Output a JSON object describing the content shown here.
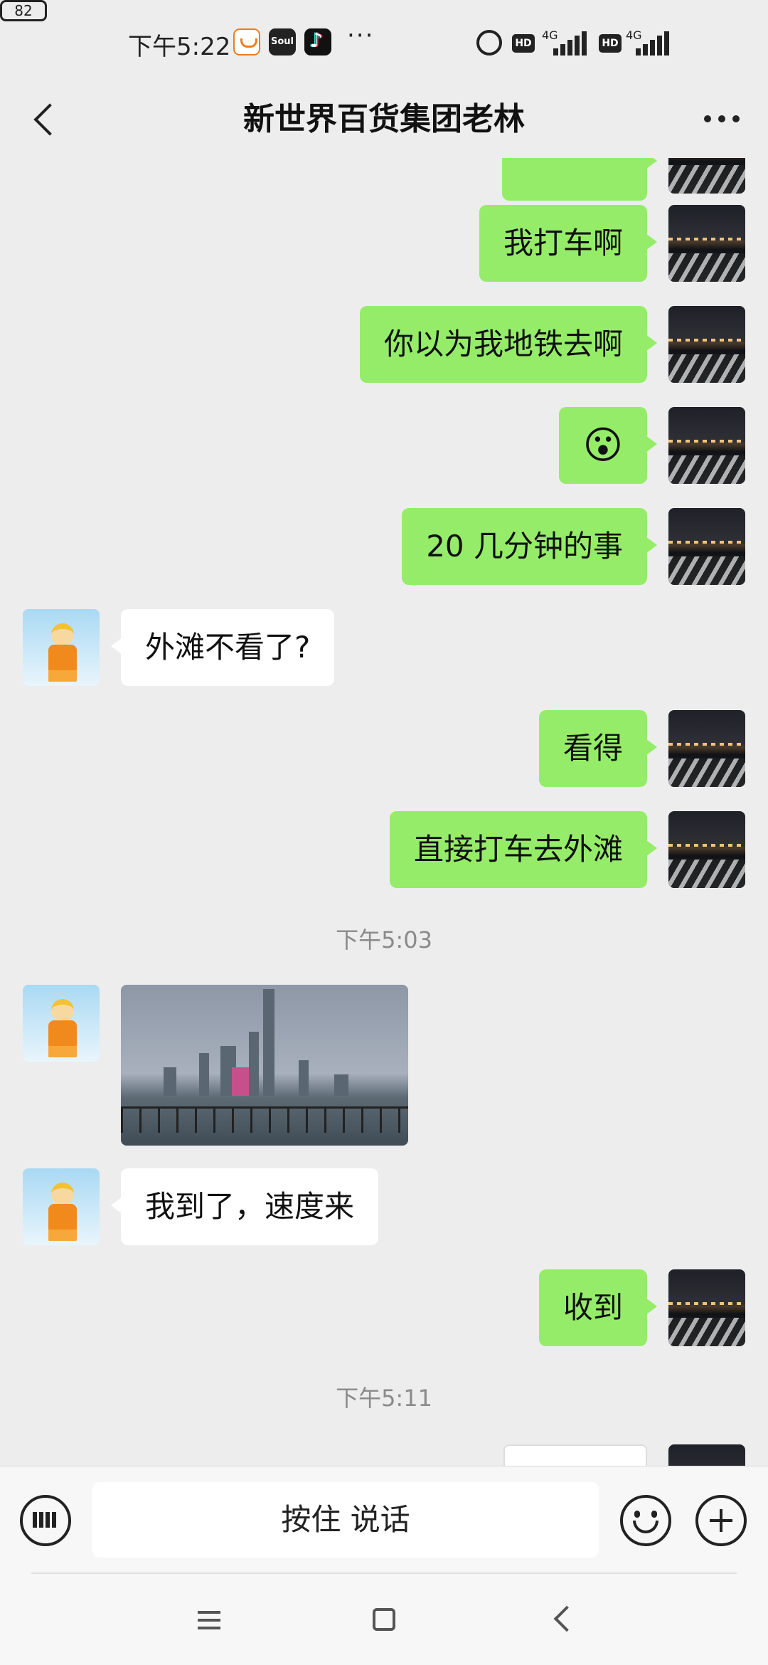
{
  "status_bar": {
    "time": "下午5:22",
    "app_icons": [
      "didi-icon",
      "soul-icon",
      "tiktok-icon"
    ],
    "soul_label": "Soul",
    "more": "···",
    "hd": "HD",
    "network1": "4G",
    "network2": "4G",
    "battery": "82"
  },
  "header": {
    "title": "新世界百货集团老林"
  },
  "messages": [
    {
      "side": "out",
      "text": "我打车啊"
    },
    {
      "side": "out",
      "text": "你以为我地铁去啊"
    },
    {
      "side": "out",
      "text": "😮"
    },
    {
      "side": "out",
      "text": "20 几分钟的事"
    },
    {
      "side": "in",
      "text": "外滩不看了?"
    },
    {
      "side": "out",
      "text": "看得"
    },
    {
      "side": "out",
      "text": "直接打车去外滩"
    },
    {
      "side": "time",
      "text": "下午5:03"
    },
    {
      "side": "in",
      "type": "image"
    },
    {
      "side": "in",
      "text": "我到了，速度来"
    },
    {
      "side": "out",
      "text": "收到"
    },
    {
      "side": "time",
      "text": "下午5:11"
    }
  ],
  "input_bar": {
    "hold_to_talk": "按住 说话"
  },
  "colors": {
    "outgoing_bubble": "#95ec69",
    "incoming_bubble": "#ffffff",
    "background": "#ededed"
  }
}
